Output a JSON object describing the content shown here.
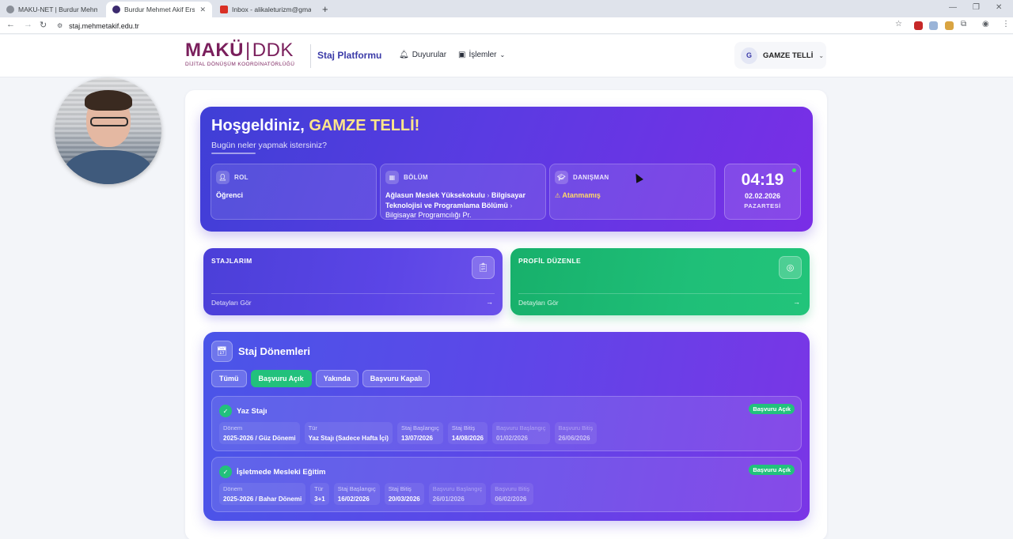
{
  "browser": {
    "tabs": [
      {
        "title": "MAKU-NET | Burdur Mehmet Akif",
        "active": false,
        "favicon_color": "#8a8f98"
      },
      {
        "title": "Burdur Mehmet Akif Ersoy",
        "active": true,
        "favicon_color": "#3b2a6e"
      },
      {
        "title": "Inbox - alikaleturizm@gmail.com",
        "active": false,
        "favicon_color": "#d93025"
      }
    ],
    "url": "staj.mehmetakif.edu.tr"
  },
  "header": {
    "logo_main": "MAKÜ",
    "logo_ddk": "DDK",
    "logo_sub": "DİJİTAL DÖNÜŞÜM KOORDİNATÖRLÜĞÜ",
    "platform": "Staj Platformu",
    "nav": {
      "announcements": "Duyurular",
      "operations": "İşlemler"
    },
    "user": {
      "initial": "G",
      "name": "GAMZE TELLİ"
    }
  },
  "hero": {
    "greeting": "Hoşgeldiniz,",
    "name": "GAMZE TELLİ!",
    "subtitle": "Bugün neler yapmak istersiniz?",
    "role": {
      "label": "ROL",
      "value": "Öğrenci"
    },
    "department": {
      "label": "BÖLÜM",
      "school": "Ağlasun Meslek Yüksekokulu",
      "dept": "Bilgisayar Teknolojisi ve Programlama Bölümü",
      "program": "Bilgisayar Programcılığı Pr."
    },
    "advisor": {
      "label": "DANIŞMAN",
      "value": "Atanmamış"
    },
    "clock": {
      "time": "04:19",
      "date": "02.02.2026",
      "day": "PAZARTESİ"
    }
  },
  "cards": {
    "internships": {
      "title": "STAJLARIM",
      "link": "Detayları Gör"
    },
    "profile": {
      "title": "PROFİL DÜZENLE",
      "link": "Detayları Gör"
    }
  },
  "periods": {
    "title": "Staj Dönemleri",
    "filters": [
      "Tümü",
      "Başvuru Açık",
      "Yakında",
      "Başvuru Kapalı"
    ],
    "active_filter": "Başvuru Açık",
    "items": [
      {
        "name": "Yaz Stajı",
        "badge": "Başvuru Açık",
        "fields": [
          {
            "label": "Dönem",
            "value": "2025-2026 / Güz Dönemi"
          },
          {
            "label": "Tür",
            "value": "Yaz Stajı (Sadece Hafta İçi)"
          },
          {
            "label": "Staj Başlangıç",
            "value": "13/07/2026"
          },
          {
            "label": "Staj Bitiş",
            "value": "14/08/2026"
          },
          {
            "label": "Başvuru Başlangıç",
            "value": "01/02/2026"
          },
          {
            "label": "Başvuru Bitiş",
            "value": "26/06/2026"
          }
        ]
      },
      {
        "name": "İşletmede Mesleki Eğitim",
        "badge": "Başvuru Açık",
        "fields": [
          {
            "label": "Dönem",
            "value": "2025-2026 / Bahar Dönemi"
          },
          {
            "label": "Tür",
            "value": "3+1"
          },
          {
            "label": "Staj Başlangıç",
            "value": "16/02/2026"
          },
          {
            "label": "Staj Bitiş",
            "value": "20/03/2026"
          },
          {
            "label": "Başvuru Başlangıç",
            "value": "26/01/2026"
          },
          {
            "label": "Başvuru Bitiş",
            "value": "06/02/2026"
          }
        ]
      }
    ]
  },
  "colors": {
    "primary": "#4b3fd8",
    "accent_green": "#22c17c",
    "warning": "#ffd966"
  }
}
